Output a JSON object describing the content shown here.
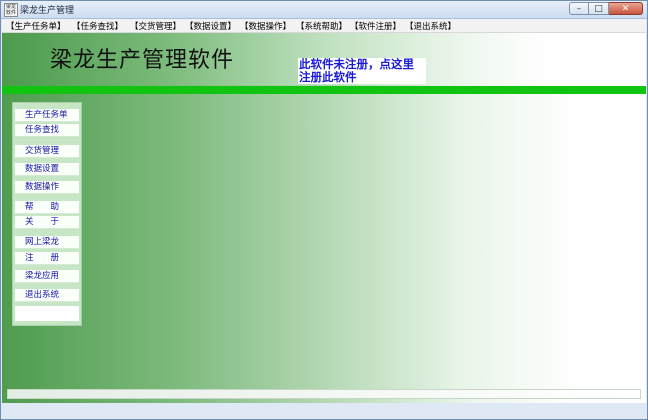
{
  "window": {
    "title": "梁龙生产管理",
    "icon_text": "梁龙软件",
    "minimize_glyph": "–",
    "maximize_glyph": "□",
    "close_glyph": "✕"
  },
  "menu": [
    "【生产任务单】",
    "【任务查找】",
    "【交货管理】",
    "【数据设置】",
    "【数据操作】",
    "【系统帮助】",
    "【软件注册】",
    "【退出系统】"
  ],
  "header": {
    "app_title": "梁龙生产管理软件",
    "register_notice_line1": "此软件未注册，点这里",
    "register_notice_line2": "注册此软件"
  },
  "sidebar": [
    "生产任务单",
    "任务查找",
    "交货管理",
    "数据设置",
    "数据操作",
    "帮　　助",
    "关　　于",
    "网上梁龙",
    "注　　册",
    "梁龙应用",
    "退出系统"
  ],
  "colors": {
    "accent_green": "#11c411",
    "link_blue": "#1a1ad6",
    "sidebar_bg": "#c6e6c6"
  }
}
